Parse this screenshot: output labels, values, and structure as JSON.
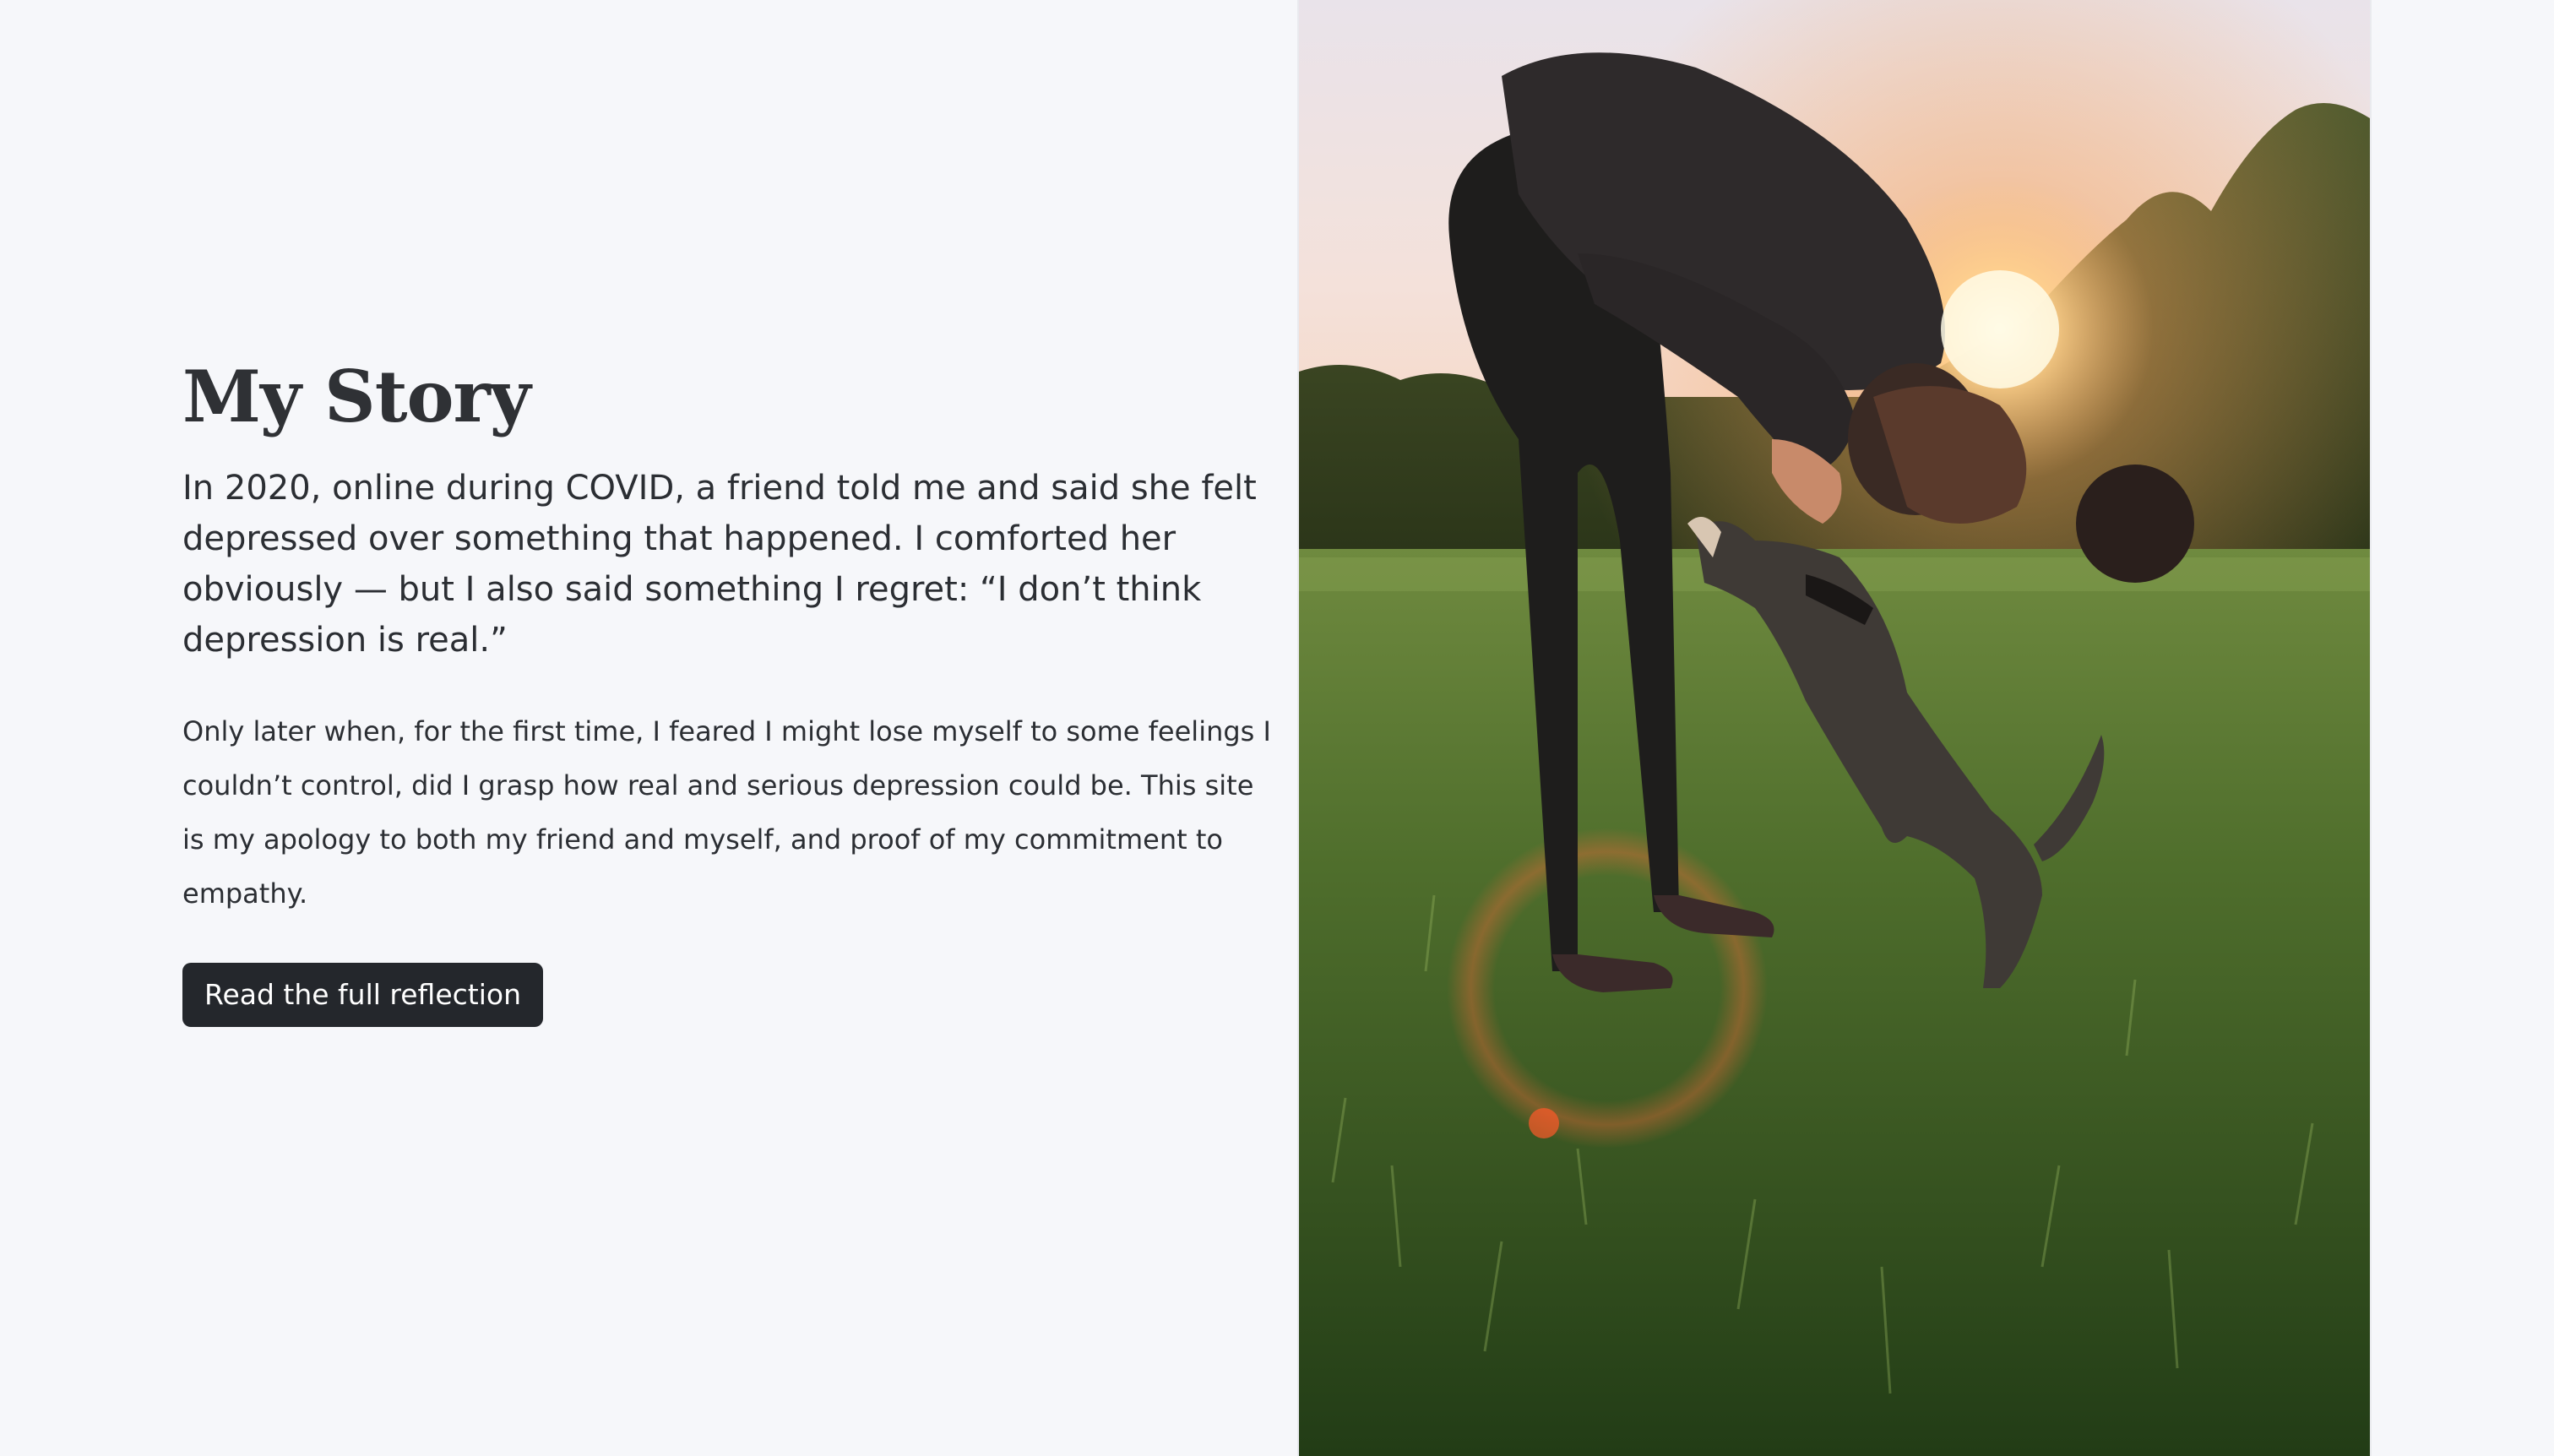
{
  "story": {
    "title": "My Story",
    "lead": "In 2020, online during COVID, a friend told me and said she felt depressed over something that happened. I comforted her obviously — but I also said something I regret: “I don’t think depression is real.”",
    "body": "Only later when, for the first time, I feared I might lose myself to some feelings I couldn’t control, did I grasp how real and serious depression could be. This site is my apology to both my friend and myself, and proof of my commitment to empathy.",
    "button_label": "Read the full reflection"
  },
  "colors": {
    "page_background": "#f6f7fa",
    "text": "#2b2e33",
    "button_background": "#24272c",
    "button_text": "#ffffff"
  }
}
